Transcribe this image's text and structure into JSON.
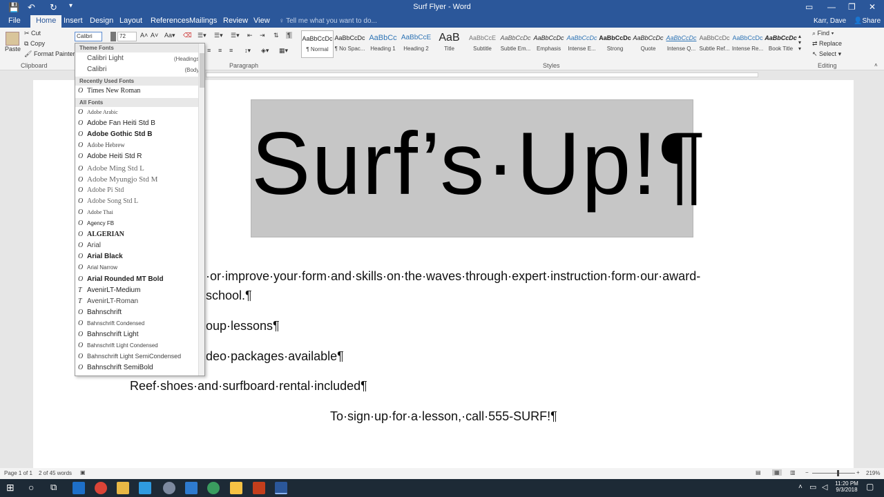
{
  "window": {
    "title": "Surf Flyer - Word"
  },
  "tabs": [
    "File",
    "Home",
    "Insert",
    "Design",
    "Layout",
    "References",
    "Mailings",
    "Review",
    "View"
  ],
  "active_tab": "Home",
  "tell_me": "Tell me what you want to do...",
  "user": {
    "name": "Karr, Dave",
    "share": "Share"
  },
  "clipboard": {
    "paste": "Paste",
    "cut": "Cut",
    "copy": "Copy",
    "format_painter": "Format Painter",
    "label": "Clipboard"
  },
  "font": {
    "name": "Calibri",
    "size": "72"
  },
  "groups": {
    "paragraph": "Paragraph",
    "styles": "Styles",
    "editing": "Editing"
  },
  "styles": [
    {
      "preview": "AaBbCcDc",
      "name": "¶ Normal"
    },
    {
      "preview": "AaBbCcDc",
      "name": "¶ No Spac..."
    },
    {
      "preview": "AaBbCc",
      "name": "Heading 1"
    },
    {
      "preview": "AaBbCcE",
      "name": "Heading 2"
    },
    {
      "preview": "AaB",
      "name": "Title"
    },
    {
      "preview": "AaBbCcE",
      "name": "Subtitle"
    },
    {
      "preview": "AaBbCcDc",
      "name": "Subtle Em..."
    },
    {
      "preview": "AaBbCcDc",
      "name": "Emphasis"
    },
    {
      "preview": "AaBbCcDc",
      "name": "Intense E..."
    },
    {
      "preview": "AaBbCcDc",
      "name": "Strong"
    },
    {
      "preview": "AaBbCcDc",
      "name": "Quote"
    },
    {
      "preview": "AaBbCcDc",
      "name": "Intense Q..."
    },
    {
      "preview": "AaBbCcDc",
      "name": "Subtle Ref..."
    },
    {
      "preview": "AaBbCcDc",
      "name": "Intense Re..."
    },
    {
      "preview": "AaBbCcDc",
      "name": "Book Title"
    }
  ],
  "editing": {
    "find": "Find",
    "replace": "Replace",
    "select": "Select"
  },
  "font_dropdown": {
    "theme_header": "Theme Fonts",
    "theme_fonts": [
      {
        "name": "Calibri Light",
        "tag": "(Headings)"
      },
      {
        "name": "Calibri",
        "tag": "(Body)"
      }
    ],
    "recent_header": "Recently Used Fonts",
    "recent_fonts": [
      "Times New Roman"
    ],
    "all_header": "All Fonts",
    "all_fonts": [
      "Adobe Arabic",
      "Adobe Fan Heiti Std B",
      "Adobe Gothic Std B",
      "Adobe Hebrew",
      "Adobe Heiti Std R",
      "Adobe Ming Std L",
      "Adobe Myungjo Std M",
      "Adobe Pi Std",
      "Adobe Song Std L",
      "Adobe Thai",
      "Agency FB",
      "ALGERIAN",
      "Arial",
      "Arial Black",
      "Arial Narrow",
      "Arial Rounded MT Bold",
      "AvenirLT-Medium",
      "AvenirLT-Roman",
      "Bahnschrift",
      "Bahnschrift Condensed",
      "Bahnschrift Light",
      "Bahnschrift Light Condensed",
      "Bahnschrift Light SemiCondensed",
      "Bahnschrift SemiBold"
    ]
  },
  "document": {
    "banner": "Surf’s·Up!¶",
    "line1": "·or·improve·your·form·and·skills·on·the·waves·through·expert·instruction·form·our·award-",
    "line2": "school.¶",
    "line3": "oup·lessons¶",
    "line4": "deo·packages·available¶",
    "line5": "Reef·shoes·and·surfboard·rental·included¶",
    "line6": "To·sign·up·for·a·lesson,·call·555-SURF!¶"
  },
  "status": {
    "page": "Page 1 of 1",
    "words": "2 of 45 words",
    "zoom": "219%"
  },
  "clock": {
    "time": "11:20 PM",
    "date": "9/3/2018"
  },
  "colors": {
    "accent": "#2b579a",
    "banner_bg": "#c6c6c6"
  }
}
